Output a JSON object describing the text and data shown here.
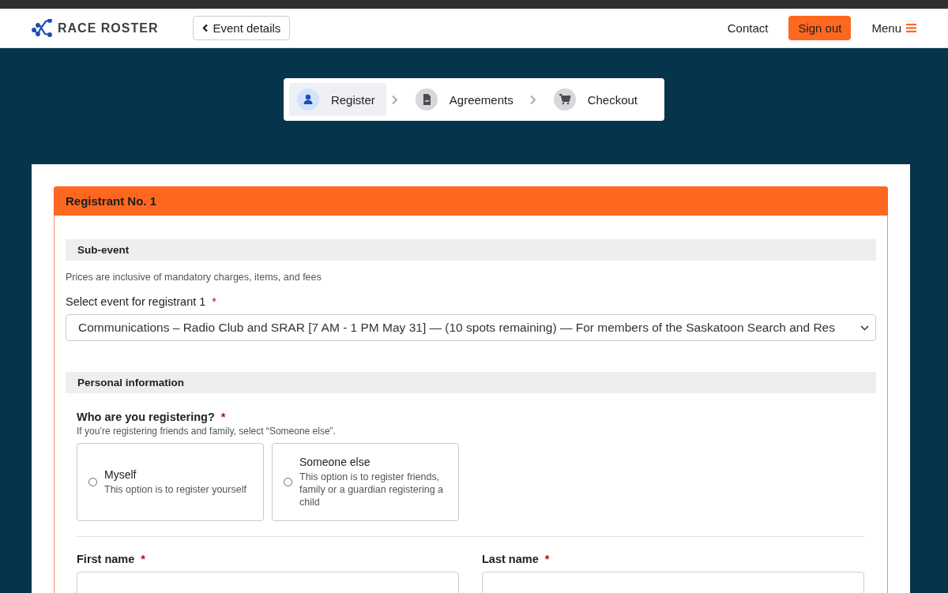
{
  "header": {
    "logo_text": "RACE ROSTER",
    "back_button": "Event details",
    "contact": "Contact",
    "sign_out": "Sign out",
    "menu": "Menu"
  },
  "steps": [
    {
      "label": "Register",
      "kind": "person",
      "selected": true
    },
    {
      "label": "Agreements",
      "kind": "document",
      "selected": false
    },
    {
      "label": "Checkout",
      "kind": "cart",
      "selected": false
    }
  ],
  "panel": {
    "title": "Registrant No. 1",
    "sub_event": {
      "heading": "Sub-event",
      "note": "Prices are inclusive of mandatory charges, items, and fees",
      "label": "Select event for registrant 1",
      "required_mark": "*",
      "value": "Communications – Radio Club and SRAR [7 AM - 1 PM May 31] — (10 spots remaining) — For members of the Saskatoon Search and Res"
    },
    "personal": {
      "heading": "Personal information",
      "question": "Who are you registering?",
      "required_mark": "*",
      "hint": "If you’re registering friends and family, select “Someone else”.",
      "options": [
        {
          "title": "Myself",
          "description": "This option is to register yourself",
          "checked": false
        },
        {
          "title": "Someone else",
          "description": "This option is to register friends, family or a guardian registering a child",
          "checked": false
        }
      ],
      "fields": [
        {
          "label": "First name",
          "required_mark": "*"
        },
        {
          "label": "Last name",
          "required_mark": "*"
        }
      ]
    }
  }
}
